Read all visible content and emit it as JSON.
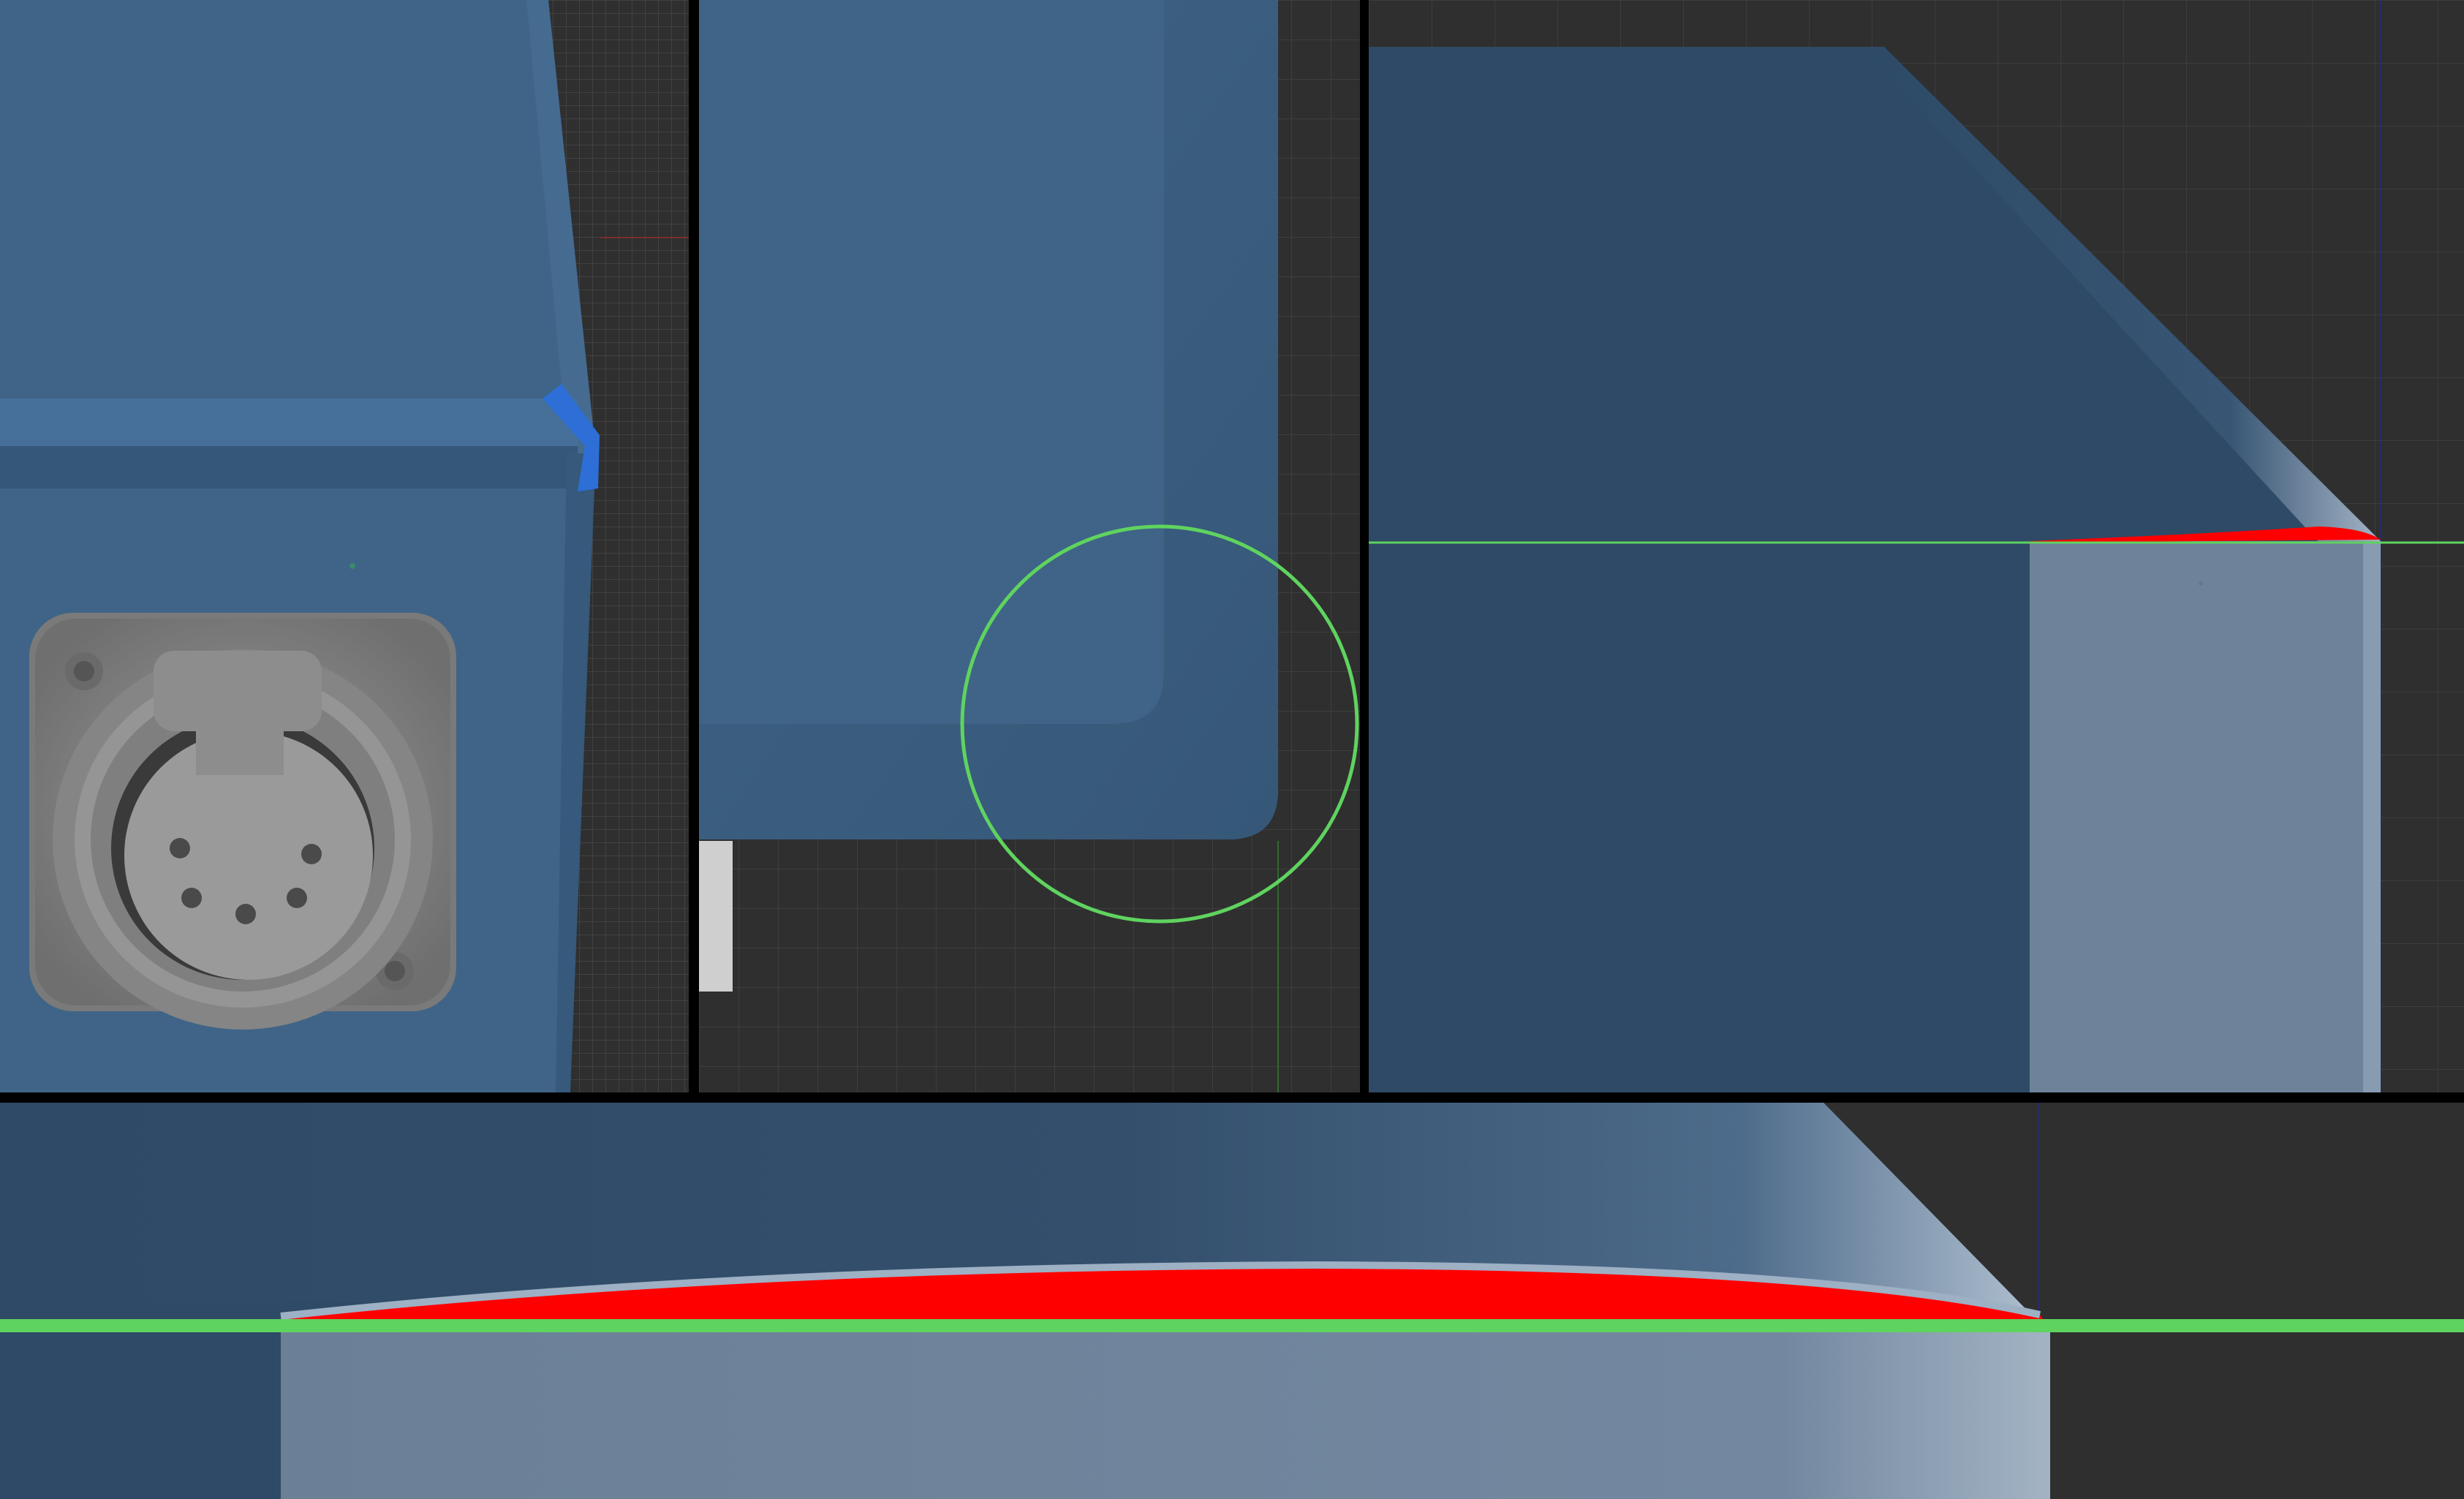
{
  "app": {
    "layout": "four-viewport-split",
    "colors": {
      "frame": "#000000",
      "grid_background": "#2f2f2f",
      "grid_line": "#3d3d3d",
      "grid_line_major": "#454545",
      "model_body": "#3f6487",
      "model_body_shadow": "#2d4a66",
      "model_side": "#2f4a65",
      "highlight_green": "#5fd35f",
      "deviation_red": "#ff0000",
      "bright_blue_marker": "#2d6fd6",
      "connector_gray": "#8a8a8a",
      "translucent_block": "#7890a6"
    }
  },
  "viewports": [
    {
      "id": "enclosure-perspective",
      "icons": [
        "xlr-connector-icon",
        "edge-marker-icon"
      ],
      "connector": {
        "type": "XLR female",
        "pins": 5
      }
    },
    {
      "id": "corner-closeup-top",
      "icons": [
        "selection-circle-icon"
      ]
    },
    {
      "id": "profile-section-side",
      "icons": [
        "reference-line-icon",
        "deviation-highlight-icon"
      ]
    },
    {
      "id": "profile-section-zoomed",
      "icons": [
        "reference-line-icon",
        "deviation-highlight-icon"
      ]
    }
  ]
}
